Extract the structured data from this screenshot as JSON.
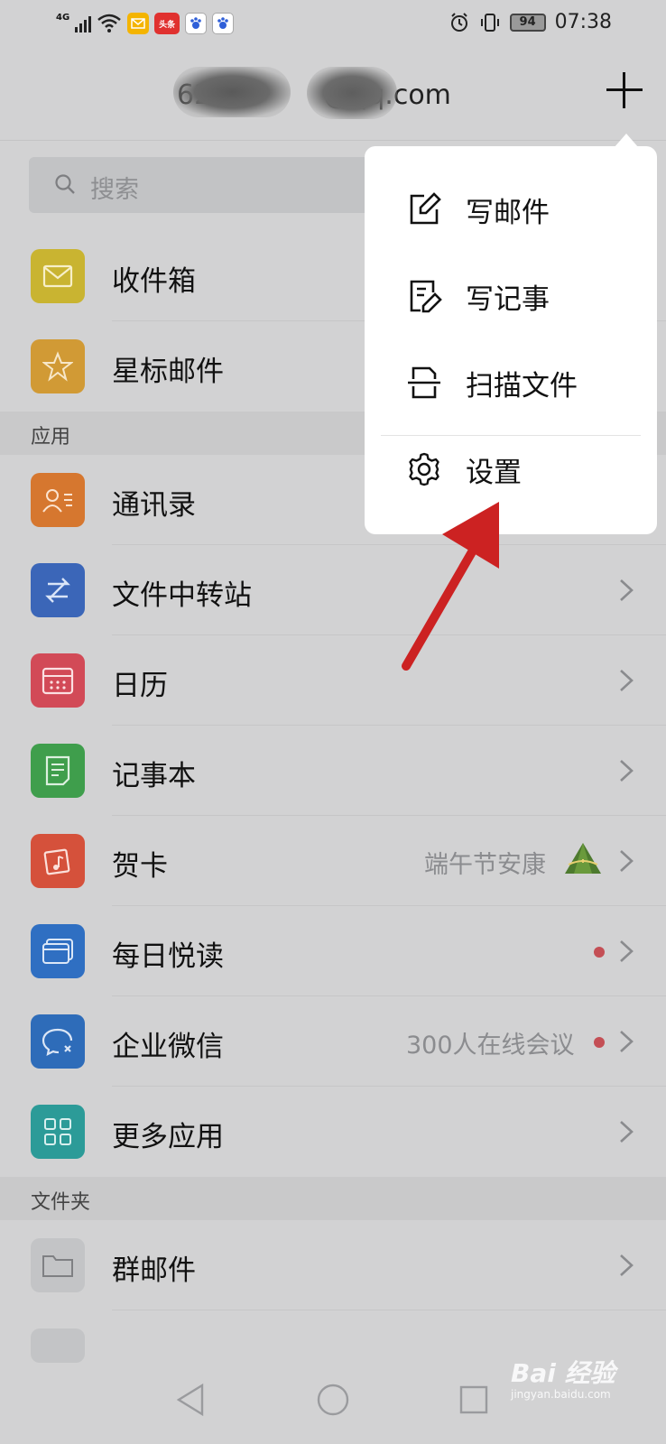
{
  "status_bar": {
    "network": "4G",
    "time": "07:38",
    "battery": "94",
    "app_badges": [
      "头条"
    ]
  },
  "header": {
    "account_visible": "62007",
    "account_suffix": "@qq.com"
  },
  "search": {
    "placeholder": "搜索"
  },
  "mailboxes": [
    {
      "label": "收件箱",
      "icon": "envelope-icon",
      "color": "#c9b431"
    },
    {
      "label": "星标邮件",
      "icon": "star-icon",
      "color": "#d19a35"
    }
  ],
  "sections": {
    "apps": "应用",
    "folders": "文件夹"
  },
  "apps": [
    {
      "label": "通讯录",
      "icon": "contacts-icon",
      "color": "#d6772f"
    },
    {
      "label": "文件中转站",
      "icon": "transfer-icon",
      "color": "#3b66b8"
    },
    {
      "label": "日历",
      "icon": "calendar-icon",
      "color": "#d24a57"
    },
    {
      "label": "记事本",
      "icon": "notepad-icon",
      "color": "#3f9e4c"
    },
    {
      "label": "贺卡",
      "icon": "greeting-card-icon",
      "color": "#d5513b",
      "extra": "端午节安康"
    },
    {
      "label": "每日悦读",
      "icon": "reading-icon",
      "color": "#2f6fc2"
    },
    {
      "label": "企业微信",
      "icon": "wecom-icon",
      "color": "#2e6cb9",
      "extra": "300人在线会议"
    },
    {
      "label": "更多应用",
      "icon": "grid-icon",
      "color": "#2c9b98"
    }
  ],
  "folders": [
    {
      "label": "群邮件",
      "icon": "folder-icon",
      "color": "#c3c4c6"
    }
  ],
  "menu": {
    "items": [
      {
        "label": "写邮件",
        "icon": "compose-icon"
      },
      {
        "label": "写记事",
        "icon": "note-edit-icon"
      },
      {
        "label": "扫描文件",
        "icon": "scan-icon"
      },
      {
        "label": "设置",
        "icon": "gear-icon"
      }
    ]
  },
  "watermark": {
    "text": "Bai 经验",
    "sub": "jingyan.baidu.com"
  }
}
